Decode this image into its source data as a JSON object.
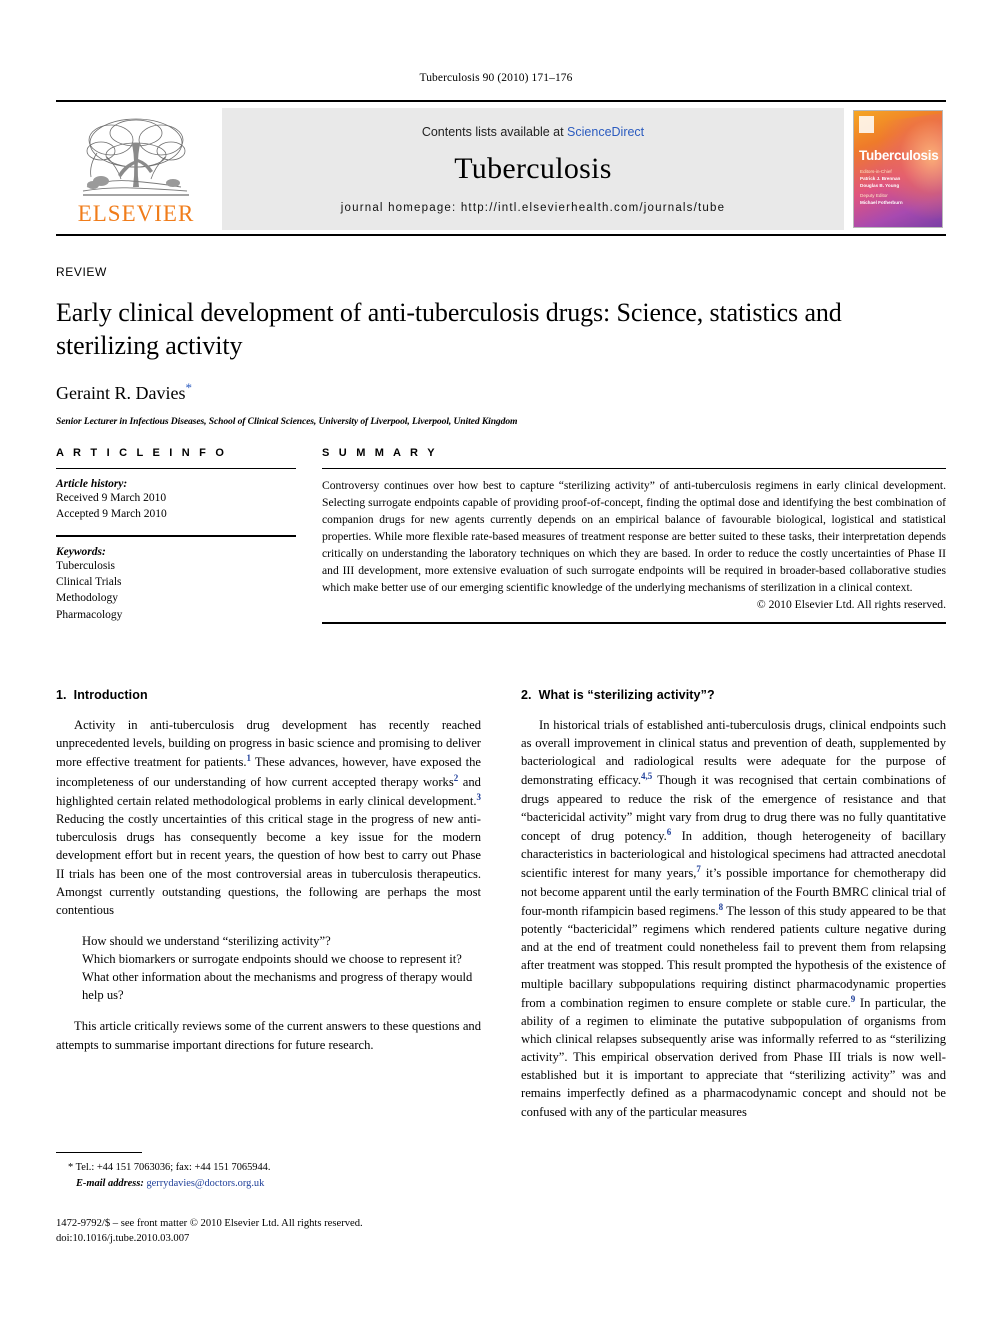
{
  "running_head": "Tuberculosis 90 (2010) 171–176",
  "masthead": {
    "publisher": "ELSEVIER",
    "contents_prefix": "Contents lists available at ",
    "contents_link": "ScienceDirect",
    "journal_name": "Tuberculosis",
    "homepage": "journal homepage: http://intl.elsevierhealth.com/journals/tube",
    "cover": {
      "title": "Tuberculosis",
      "editors_label": "Editors-in-Chief",
      "editor_1": "Patrick J. Brennan",
      "editor_2": "Douglas B. Young",
      "assoc_label": "Deputy Editor",
      "assoc_editor": "Michael Fotherburn"
    }
  },
  "article": {
    "kicker": "REVIEW",
    "title": "Early clinical development of anti-tuberculosis drugs: Science, statistics and sterilizing activity",
    "author": "Geraint R. Davies",
    "author_marker": "*",
    "affiliation": "Senior Lecturer in Infectious Diseases, School of Clinical Sciences, University of Liverpool, Liverpool, United Kingdom"
  },
  "info": {
    "label": "A R T I C L E   I N F O",
    "history_label": "Article history:",
    "received": "Received 9 March 2010",
    "accepted": "Accepted 9 March 2010",
    "keywords_label": "Keywords:",
    "keywords": [
      "Tuberculosis",
      "Clinical Trials",
      "Methodology",
      "Pharmacology"
    ]
  },
  "summary": {
    "label": "S U M M A R Y",
    "text": "Controversy continues over how best to capture “sterilizing activity” of anti-tuberculosis regimens in early clinical development. Selecting surrogate endpoints capable of providing proof-of-concept, finding the optimal dose and identifying the best combination of companion drugs for new agents currently depends on an empirical balance of favourable biological, logistical and statistical properties. While more flexible rate-based measures of treatment response are better suited to these tasks, their interpretation depends critically on understanding the laboratory techniques on which they are based. In order to reduce the costly uncertainties of Phase II and III development, more extensive evaluation of such surrogate endpoints will be required in broader-based collaborative studies which make better use of our emerging scientific knowledge of the underlying mechanisms of sterilization in a clinical context.",
    "copyright": "© 2010 Elsevier Ltd. All rights reserved."
  },
  "sections": {
    "intro": {
      "number": "1.",
      "heading": "Introduction",
      "para1_a": "Activity in anti-tuberculosis drug development has recently reached unprecedented levels, building on progress in basic science and promising to deliver more effective treatment for patients.",
      "ref1": "1",
      "para1_b": " These advances, however, have exposed the incompleteness of our understanding of how current accepted therapy works",
      "ref2": "2",
      "para1_c": " and highlighted certain related methodological problems in early clinical development.",
      "ref3": "3",
      "para1_d": " Reducing the costly uncertainties of this critical stage in the progress of new anti-tuberculosis drugs has consequently become a key issue for the modern development effort but in recent years, the question of how best to carry out Phase II trials has been one of the most controversial areas in tuberculosis therapeutics. Amongst currently outstanding questions, the following are perhaps the most contentious",
      "questions": [
        "How should we understand “sterilizing activity”?",
        "Which biomarkers or surrogate endpoints should we choose to represent it?",
        "What other information about the mechanisms and progress of therapy would help us?"
      ],
      "para2": "This article critically reviews some of the current answers to these questions and attempts to summarise important directions for future research."
    },
    "sterilizing": {
      "number": "2.",
      "heading": "What is “sterilizing activity”?",
      "p_a": "In historical trials of established anti-tuberculosis drugs, clinical endpoints such as overall improvement in clinical status and prevention of death, supplemented by bacteriological and radiological results were adequate for the purpose of demonstrating efficacy.",
      "ref45": "4,5",
      "p_b": " Though it was recognised that certain combinations of drugs appeared to reduce the risk of the emergence of resistance and that “bactericidal activity” might vary from drug to drug there was no fully quantitative concept of drug potency.",
      "ref6": "6",
      "p_c": " In addition, though heterogeneity of bacillary characteristics in bacteriological and histological specimens had attracted anecdotal scientific interest for many years,",
      "ref7": "7",
      "p_d": " it’s possible importance for chemotherapy did not become apparent until the early termination of the Fourth BMRC clinical trial of four-month rifampicin based regimens.",
      "ref8": "8",
      "p_e": " The lesson of this study appeared to be that potently “bactericidal” regimens which rendered patients culture negative during and at the end of treatment could nonetheless fail to prevent them from relapsing after treatment was stopped. This result prompted the hypothesis of the existence of multiple bacillary subpopulations requiring distinct pharmacodynamic properties from a combination regimen to ensure complete or stable cure.",
      "ref9": "9",
      "p_f": " In particular, the ability of a regimen to eliminate the putative subpopulation of organisms from which clinical relapses subsequently arise was informally referred to as “sterilizing activity”. This empirical observation derived from Phase III trials is now well-established but it is important to appreciate that “sterilizing activity” was and remains imperfectly defined as a pharmacodynamic concept and should not be confused with any of the particular measures"
    }
  },
  "footnotes": {
    "marker": "*",
    "contact": "Tel.: +44 151 7063036; fax: +44 151 7065944.",
    "email_label": "E-mail address:",
    "email": "gerrydavies@doctors.org.uk"
  },
  "imprint": {
    "line1": "1472-9792/$ – see front matter © 2010 Elsevier Ltd. All rights reserved.",
    "line2": "doi:10.1016/j.tube.2010.03.007"
  }
}
